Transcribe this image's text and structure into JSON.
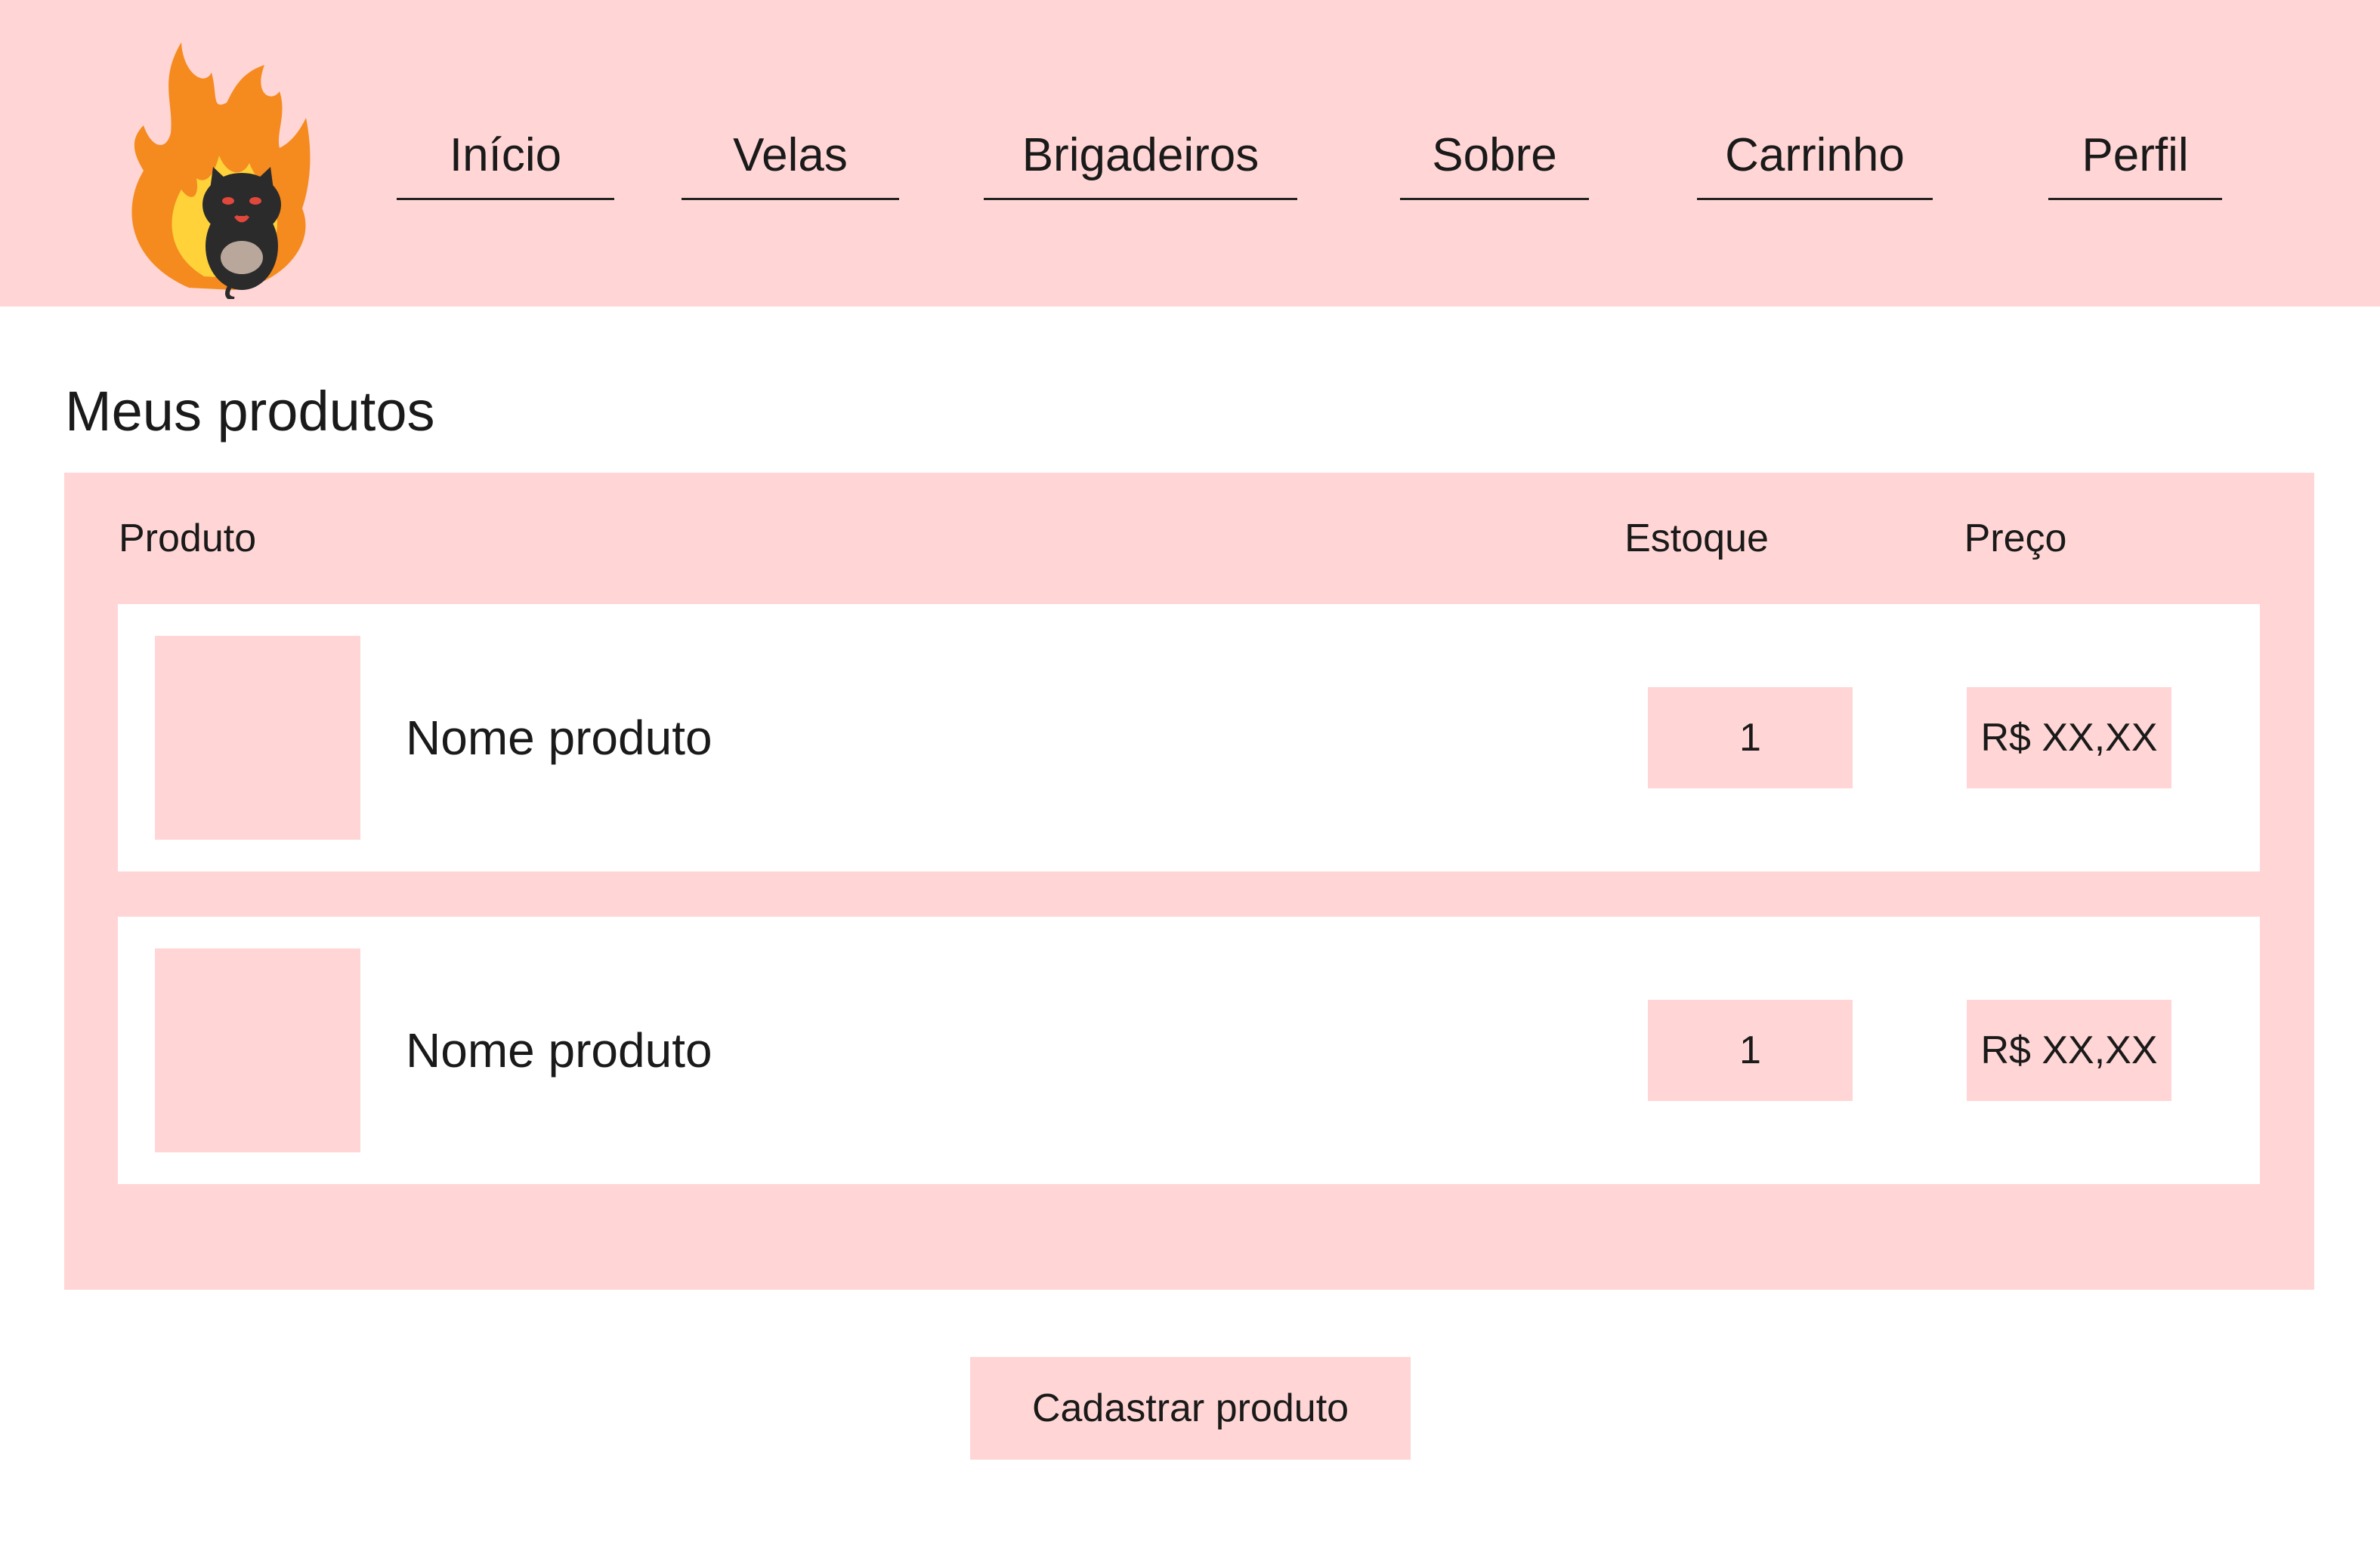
{
  "logo": {
    "icon": "flame-cat-logo-icon"
  },
  "nav": {
    "items": [
      {
        "label": "Início"
      },
      {
        "label": "Velas"
      },
      {
        "label": "Brigadeiros"
      },
      {
        "label": "Sobre"
      },
      {
        "label": "Carrinho"
      },
      {
        "label": "Perfil"
      }
    ]
  },
  "main": {
    "title": "Meus produtos",
    "table": {
      "headers": {
        "product": "Produto",
        "stock": "Estoque",
        "price": "Preço"
      },
      "rows": [
        {
          "name": "Nome produto",
          "stock": "1",
          "price": "R$ XX,XX"
        },
        {
          "name": "Nome produto",
          "stock": "1",
          "price": "R$ XX,XX"
        }
      ]
    },
    "register_button": "Cadastrar produto"
  },
  "colors": {
    "accent": "#ffd6d5",
    "background": "#ffffff",
    "text": "#1a1a1a",
    "flame_outer": "#f58a1f",
    "flame_inner": "#ffd23a",
    "cat": "#2b2b2b"
  }
}
